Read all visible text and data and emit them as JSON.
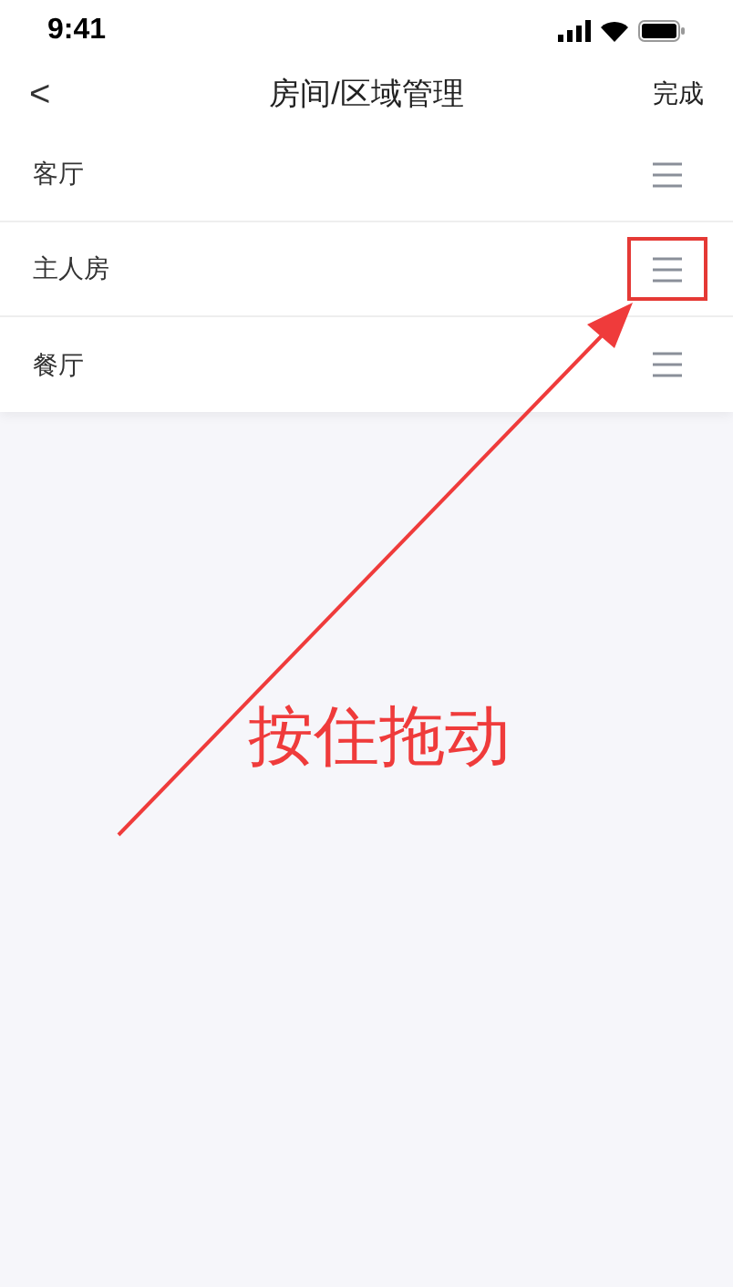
{
  "status_bar": {
    "time": "9:41"
  },
  "nav": {
    "back": "<",
    "title": "房间/区域管理",
    "action": "完成"
  },
  "rooms": [
    {
      "name": "客厅",
      "highlighted": false
    },
    {
      "name": "主人房",
      "highlighted": true
    },
    {
      "name": "餐厅",
      "highlighted": false
    }
  ],
  "annotation": {
    "text": "按住拖动"
  }
}
